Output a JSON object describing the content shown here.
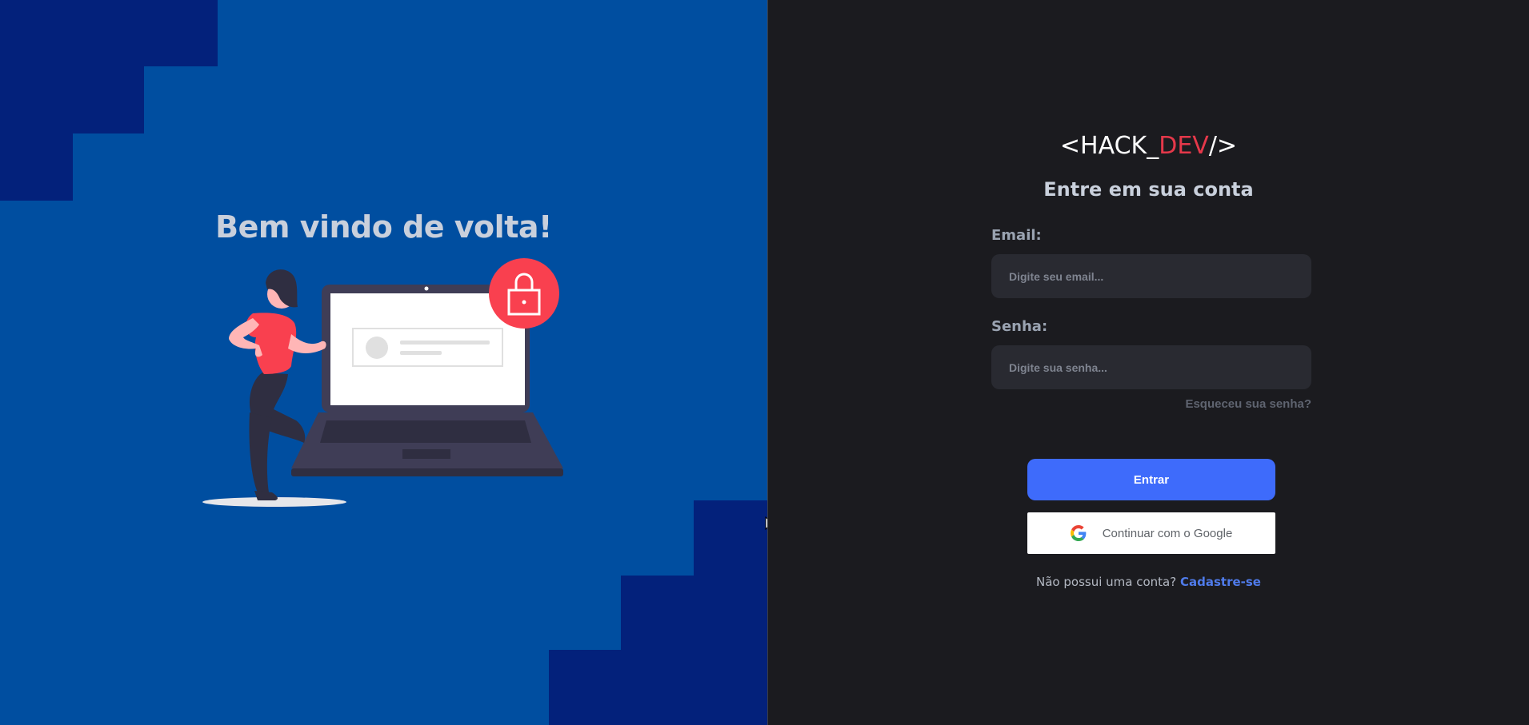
{
  "left_panel": {
    "welcome_title": "Bem vindo de volta!"
  },
  "logo": {
    "prefix": "<HACK_",
    "accent": "DEV",
    "suffix": "/>"
  },
  "login_form": {
    "title": "Entre em sua conta",
    "email_label": "Email:",
    "email_placeholder": "Digite seu email...",
    "password_label": "Senha:",
    "password_placeholder": "Digite sua senha...",
    "forgot_password": "Esqueceu sua senha?",
    "submit_label": "Entrar",
    "google_label": "Continuar com o Google",
    "signup_prompt": "Não possui uma conta?",
    "signup_link": "Cadastre-se"
  },
  "colors": {
    "left_background": "#004ea0",
    "step_shapes": "#03217b",
    "right_background": "#1b1b1f",
    "input_background": "#292a31",
    "primary_button": "#3e6bfb",
    "logo_accent": "#e5384a",
    "signup_link": "#4f7bea"
  },
  "icons": [
    "padlock-icon",
    "google-icon",
    "mouse-cursor-icon"
  ]
}
